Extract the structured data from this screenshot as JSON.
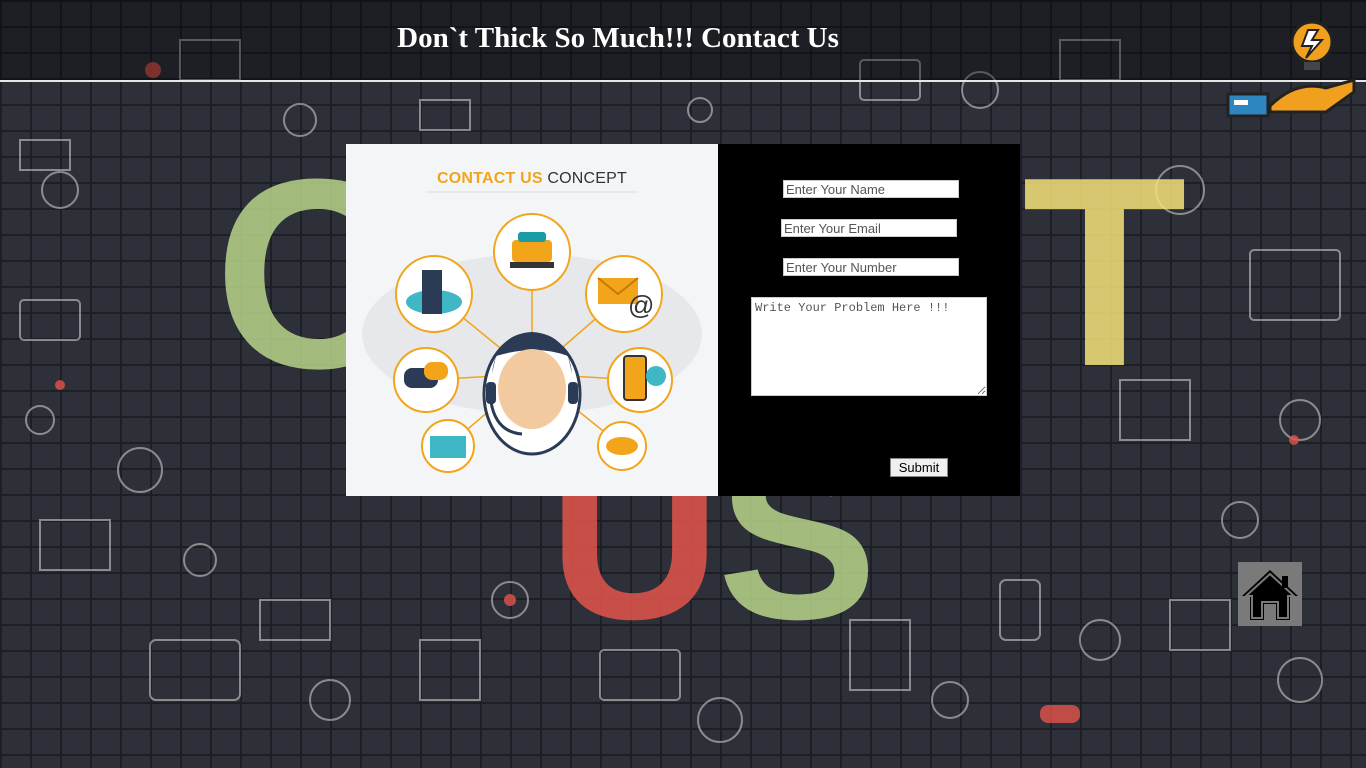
{
  "header": {
    "title": "Don`t Thick So Much!!! Contact Us"
  },
  "illustration": {
    "title_highlight": "CONTACT US",
    "title_rest": "CONCEPT"
  },
  "form": {
    "name_placeholder": "Enter Your Name",
    "email_placeholder": "Enter Your Email",
    "number_placeholder": "Enter Your Number",
    "problem_placeholder": "Write Your Problem Here !!!",
    "submit_label": "Submit"
  },
  "background": {
    "letters": [
      "C",
      "T",
      "US"
    ]
  },
  "icons": {
    "logo": "lightbulb-hand-logo-icon",
    "home": "home-icon"
  },
  "colors": {
    "header_text": "#ffffff",
    "accent_orange": "#f2a51b",
    "letter_green": "#b8d58a",
    "letter_yellow": "#f5e27a",
    "letter_red": "#e4544b"
  }
}
